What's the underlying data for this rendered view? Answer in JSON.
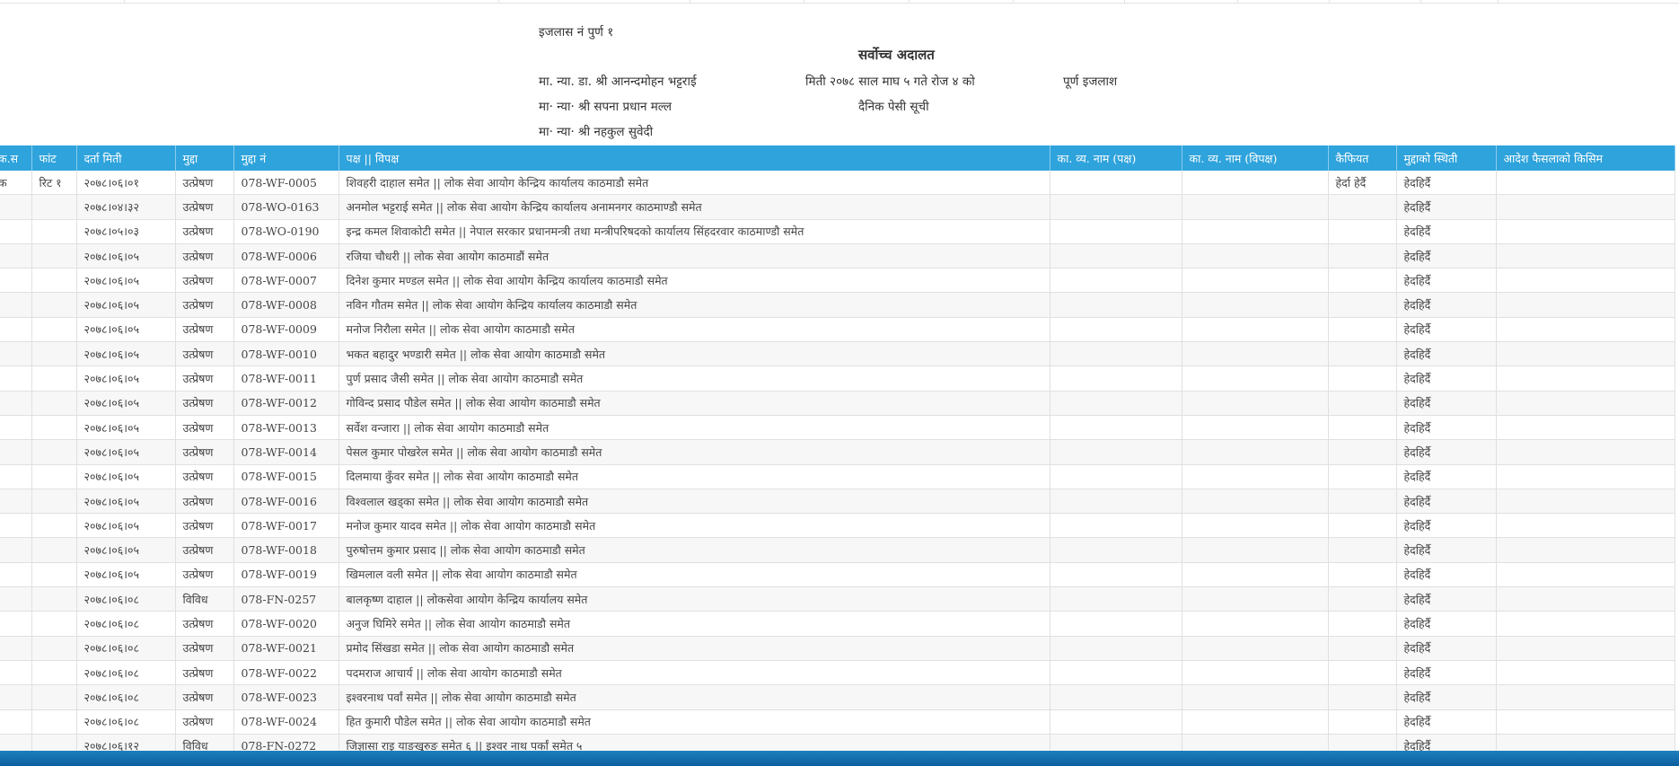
{
  "header": {
    "bench_no": "इजलास नं पुर्ण १",
    "court_name": "सर्वोच्च अदालत",
    "judge_1": "मा. न्या. डा. श्री आनन्दमोहन भट्टराई",
    "judge_2": "मा· न्या· श्री सपना प्रधान मल्ल",
    "judge_3": "मा· न्या· श्री नहकुल सुवेदी",
    "date_text": "मिती २०७८ साल माघ ५ गते रोज ४ को",
    "list_type": "दैनिक पेसी सूची",
    "bench_type": "पूर्ण इजलाश"
  },
  "table": {
    "columns": [
      "क.स",
      "फांट",
      "दर्ता मिती",
      "मुद्दा",
      "मुद्दा नं",
      "पक्ष || विपक्ष",
      "का. व्य. नाम (पक्ष)",
      "का. व्य. नाम (विपक्ष)",
      "कैफियत",
      "मुद्दाको स्थिती",
      "आदेश फैसलाको किसिम"
    ],
    "rows": [
      {
        "sn": "क",
        "font": "रिट १",
        "date": "२०७८।०६।०१",
        "type": "उत्प्रेषण",
        "case_no": "078-WF-0005",
        "parties": "शिवहरी दाहाल समेत || लोक सेवा आयोग केन्द्रिय कार्यालय काठमाडौ समेत",
        "lawyer_p": "",
        "lawyer_v": "",
        "remarks": "हेर्दा हेर्दै",
        "status": "हेदहिर्दै",
        "order": ""
      },
      {
        "sn": "",
        "font": "",
        "date": "२०७८।०४।३२",
        "type": "उत्प्रेषण",
        "case_no": "078-WO-0163",
        "parties": "अनमोल भट्टराई समेत || लोक सेवा आयोग केन्द्रिय कार्यालय अनामनगर काठमाण्डौ समेत",
        "lawyer_p": "",
        "lawyer_v": "",
        "remarks": "",
        "status": "हेदहिर्दै",
        "order": ""
      },
      {
        "sn": "",
        "font": "",
        "date": "२०७८।०५।०३",
        "type": "उत्प्रेषण",
        "case_no": "078-WO-0190",
        "parties": "इन्द्र कमल शिवाकोटी समेत || नेपाल सरकार प्रधानमन्त्री तथा मन्त्रीपरिषदको कार्यालय सिंहदरवार काठमाण्डौ समेत",
        "lawyer_p": "",
        "lawyer_v": "",
        "remarks": "",
        "status": "हेदहिर्दै",
        "order": ""
      },
      {
        "sn": "",
        "font": "",
        "date": "२०७८।०६।०५",
        "type": "उत्प्रेषण",
        "case_no": "078-WF-0006",
        "parties": "रजिया चौधरी || लोक सेवा आयोग काठमाडौं समेत",
        "lawyer_p": "",
        "lawyer_v": "",
        "remarks": "",
        "status": "हेदहिर्दै",
        "order": ""
      },
      {
        "sn": "",
        "font": "",
        "date": "२०७८।०६।०५",
        "type": "उत्प्रेषण",
        "case_no": "078-WF-0007",
        "parties": "दिनेश कुमार मण्डल समेत || लोक सेवा आयोग केन्द्रिय कार्यालय काठमाडौ समेत",
        "lawyer_p": "",
        "lawyer_v": "",
        "remarks": "",
        "status": "हेदहिर्दै",
        "order": ""
      },
      {
        "sn": "",
        "font": "",
        "date": "२०७८।०६।०५",
        "type": "उत्प्रेषण",
        "case_no": "078-WF-0008",
        "parties": "नविन गौतम समेत || लोक सेवा आयोग केन्द्रिय कार्यालय काठमाडौ समेत",
        "lawyer_p": "",
        "lawyer_v": "",
        "remarks": "",
        "status": "हेदहिर्दै",
        "order": ""
      },
      {
        "sn": "",
        "font": "",
        "date": "२०७८।०६।०५",
        "type": "उत्प्रेषण",
        "case_no": "078-WF-0009",
        "parties": "मनोज निरौला समेत || लोक सेवा आयोग काठमाडौ समेत",
        "lawyer_p": "",
        "lawyer_v": "",
        "remarks": "",
        "status": "हेदहिर्दै",
        "order": ""
      },
      {
        "sn": "",
        "font": "",
        "date": "२०७८।०६।०५",
        "type": "उत्प्रेषण",
        "case_no": "078-WF-0010",
        "parties": "भकत बहादुर भण्डारी समेत || लोक सेवा आयोग काठमाडौ समेत",
        "lawyer_p": "",
        "lawyer_v": "",
        "remarks": "",
        "status": "हेदहिर्दै",
        "order": ""
      },
      {
        "sn": "",
        "font": "",
        "date": "२०७८।०६।०५",
        "type": "उत्प्रेषण",
        "case_no": "078-WF-0011",
        "parties": "पुर्ण प्रसाद जैसी समेत || लोक सेवा आयोग काठमाडौ समेत",
        "lawyer_p": "",
        "lawyer_v": "",
        "remarks": "",
        "status": "हेदहिर्दै",
        "order": ""
      },
      {
        "sn": "",
        "font": "",
        "date": "२०७८।०६।०५",
        "type": "उत्प्रेषण",
        "case_no": "078-WF-0012",
        "parties": "गोविन्द प्रसाद पौडेल समेत || लोक सेवा आयोग काठमाडौ समेत",
        "lawyer_p": "",
        "lawyer_v": "",
        "remarks": "",
        "status": "हेदहिर्दै",
        "order": ""
      },
      {
        "sn": "",
        "font": "",
        "date": "२०७८।०६।०५",
        "type": "उत्प्रेषण",
        "case_no": "078-WF-0013",
        "parties": "सर्वेश वन्जारा || लोक सेवा आयोग काठमाडौ समेत",
        "lawyer_p": "",
        "lawyer_v": "",
        "remarks": "",
        "status": "हेदहिर्दै",
        "order": ""
      },
      {
        "sn": "",
        "font": "",
        "date": "२०७८।०६।०५",
        "type": "उत्प्रेषण",
        "case_no": "078-WF-0014",
        "parties": "पेसल कुमार पोखरेल समेत || लोक सेवा आयोग काठमाडौ समेत",
        "lawyer_p": "",
        "lawyer_v": "",
        "remarks": "",
        "status": "हेदहिर्दै",
        "order": ""
      },
      {
        "sn": "",
        "font": "",
        "date": "२०७८।०६।०५",
        "type": "उत्प्रेषण",
        "case_no": "078-WF-0015",
        "parties": "दिलमाया कुँवर समेत || लोक सेवा आयोग काठमाडौ समेत",
        "lawyer_p": "",
        "lawyer_v": "",
        "remarks": "",
        "status": "हेदहिर्दै",
        "order": ""
      },
      {
        "sn": "",
        "font": "",
        "date": "२०७८।०६।०५",
        "type": "उत्प्रेषण",
        "case_no": "078-WF-0016",
        "parties": "विश्वलाल खड्का समेत || लोक सेवा आयोग काठमाडौ समेत",
        "lawyer_p": "",
        "lawyer_v": "",
        "remarks": "",
        "status": "हेदहिर्दै",
        "order": ""
      },
      {
        "sn": "",
        "font": "",
        "date": "२०७८।०६।०५",
        "type": "उत्प्रेषण",
        "case_no": "078-WF-0017",
        "parties": "मनोज कुमार यादव समेत || लोक सेवा आयोग काठमाडौ समेत",
        "lawyer_p": "",
        "lawyer_v": "",
        "remarks": "",
        "status": "हेदहिर्दै",
        "order": ""
      },
      {
        "sn": "",
        "font": "",
        "date": "२०७८।०६।०५",
        "type": "उत्प्रेषण",
        "case_no": "078-WF-0018",
        "parties": "पुरुषोत्तम कुमार प्रसाद || लोक सेवा आयोग काठमाडौ समेत",
        "lawyer_p": "",
        "lawyer_v": "",
        "remarks": "",
        "status": "हेदहिर्दै",
        "order": ""
      },
      {
        "sn": "",
        "font": "",
        "date": "२०७८।०६।०५",
        "type": "उत्प्रेषण",
        "case_no": "078-WF-0019",
        "parties": "खिमलाल वली समेत || लोक सेवा आयोग काठमाडौ समेत",
        "lawyer_p": "",
        "lawyer_v": "",
        "remarks": "",
        "status": "हेदहिर्दै",
        "order": ""
      },
      {
        "sn": "",
        "font": "",
        "date": "२०७८।०६।०८",
        "type": "विविध",
        "case_no": "078-FN-0257",
        "parties": "बालकृष्ण दाहाल || लोकसेवा आयोग केन्द्रिय कार्यालय समेत",
        "lawyer_p": "",
        "lawyer_v": "",
        "remarks": "",
        "status": "हेदहिर्दै",
        "order": ""
      },
      {
        "sn": "",
        "font": "",
        "date": "२०७८।०६।०८",
        "type": "उत्प्रेषण",
        "case_no": "078-WF-0020",
        "parties": "अनुज घिमिरे समेत || लोक सेवा आयोग काठमाडौ समेत",
        "lawyer_p": "",
        "lawyer_v": "",
        "remarks": "",
        "status": "हेदहिर्दै",
        "order": ""
      },
      {
        "sn": "",
        "font": "",
        "date": "२०७८।०६।०८",
        "type": "उत्प्रेषण",
        "case_no": "078-WF-0021",
        "parties": "प्रमोद सिंखडा समेत || लोक सेवा आयोग काठमाडौ समेत",
        "lawyer_p": "",
        "lawyer_v": "",
        "remarks": "",
        "status": "हेदहिर्दै",
        "order": ""
      },
      {
        "sn": "",
        "font": "",
        "date": "२०७८।०६।०८",
        "type": "उत्प्रेषण",
        "case_no": "078-WF-0022",
        "parties": "पदमराज आचार्य || लोक सेवा आयोग काठमाडौ समेत",
        "lawyer_p": "",
        "lawyer_v": "",
        "remarks": "",
        "status": "हेदहिर्दै",
        "order": ""
      },
      {
        "sn": "",
        "font": "",
        "date": "२०७८।०६।०८",
        "type": "उत्प्रेषण",
        "case_no": "078-WF-0023",
        "parties": "इश्वरनाथ पर्वां समेत || लोक सेवा आयोग काठमाडौ समेत",
        "lawyer_p": "",
        "lawyer_v": "",
        "remarks": "",
        "status": "हेदहिर्दै",
        "order": ""
      },
      {
        "sn": "",
        "font": "",
        "date": "२०७८।०६।०८",
        "type": "उत्प्रेषण",
        "case_no": "078-WF-0024",
        "parties": "हित कुमारी पौडेल समेत || लोक सेवा आयोग काठमाडौ समेत",
        "lawyer_p": "",
        "lawyer_v": "",
        "remarks": "",
        "status": "हेदहिर्दै",
        "order": ""
      },
      {
        "sn": "",
        "font": "",
        "date": "२०७८।०६।१२",
        "type": "विविध",
        "case_no": "078-FN-0272",
        "parties": "जिज्ञासा राइ याङखुरुङ समेत ६ || इश्वर नाथ पर्कां समेत ५",
        "lawyer_p": "",
        "lawyer_v": "",
        "remarks": "",
        "status": "हेदहिर्दै",
        "order": ""
      }
    ]
  }
}
